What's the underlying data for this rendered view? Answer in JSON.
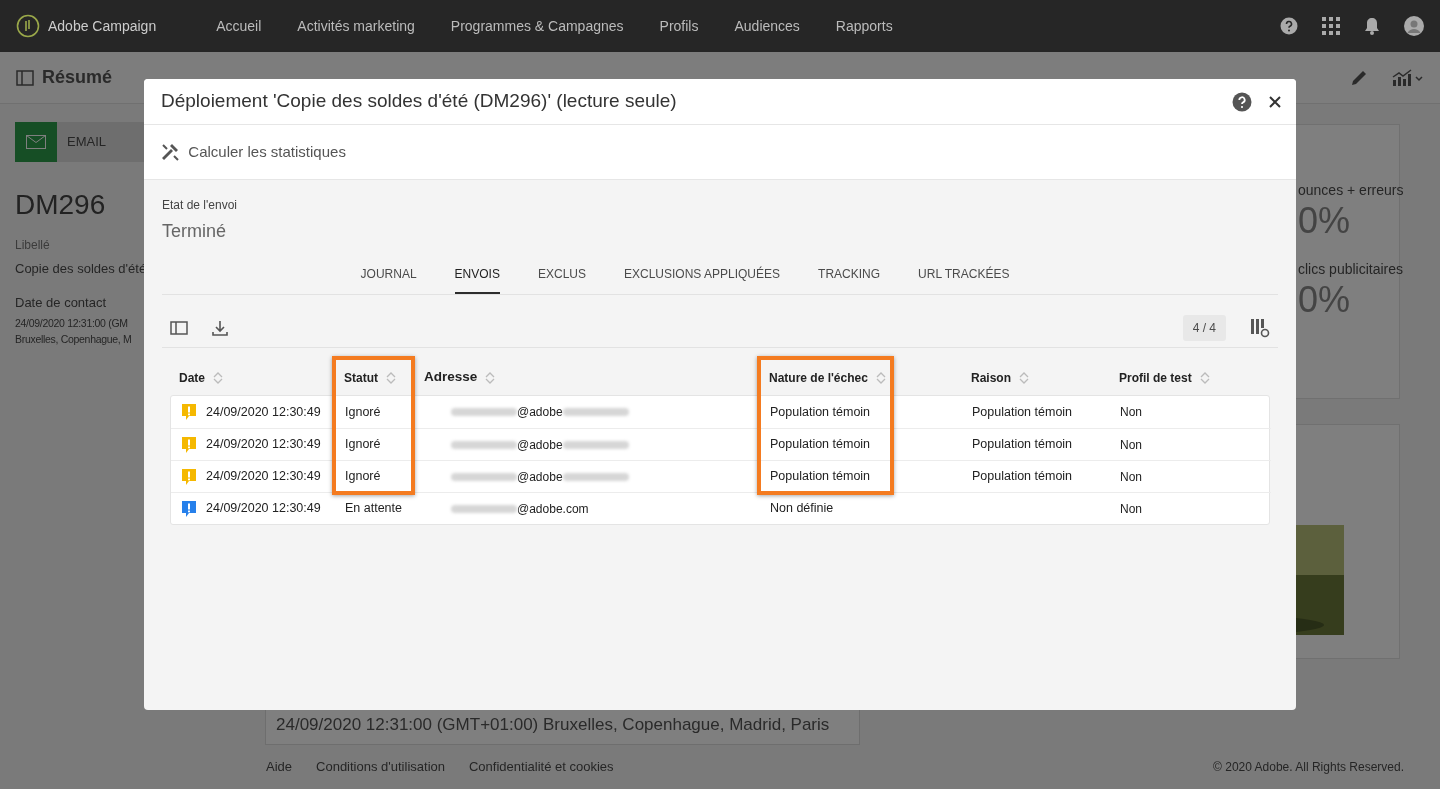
{
  "app": {
    "name": "Adobe Campaign"
  },
  "nav": [
    {
      "label": "Accueil"
    },
    {
      "label": "Activités marketing"
    },
    {
      "label": "Programmes & Campagnes"
    },
    {
      "label": "Profils"
    },
    {
      "label": "Audiences"
    },
    {
      "label": "Rapports"
    }
  ],
  "page": {
    "title": "Résumé"
  },
  "summary": {
    "channel": "EMAIL",
    "code": "DM296",
    "label_title": "Libellé",
    "label_value": "Copie des soldes d'été",
    "date_title": "Date de contact",
    "date_lines": [
      "24/09/2020 12:31:00 (GM",
      "Bruxelles, Copenhague, M"
    ]
  },
  "contact_field": "24/09/2020 12:31:00 (GMT+01:00) Bruxelles, Copenhague, Madrid, Paris",
  "stats": [
    {
      "label": "ounces + erreurs",
      "value": "0%"
    },
    {
      "label": "clics publicitaires",
      "value": "0%"
    }
  ],
  "footer": {
    "links": [
      "Aide",
      "Conditions d'utilisation",
      "Confidentialité et cookies"
    ],
    "copyright": "© 2020 Adobe. All Rights Reserved."
  },
  "dialog": {
    "title": "Déploiement 'Copie des soldes d'été (DM296)' (lecture seule)",
    "action": "Calculer les statistiques",
    "state_label": "Etat de l'envoi",
    "state_value": "Terminé",
    "tabs": [
      {
        "label": "JOURNAL",
        "selected": false
      },
      {
        "label": "ENVOIS",
        "selected": true
      },
      {
        "label": "EXCLUS",
        "selected": false
      },
      {
        "label": "EXCLUSIONS APPLIQUÉES",
        "selected": false
      },
      {
        "label": "TRACKING",
        "selected": false
      },
      {
        "label": "URL TRACKÉES",
        "selected": false
      }
    ],
    "count": "4 / 4",
    "columns": [
      {
        "label": "Date",
        "highlighted": false
      },
      {
        "label": "Statut",
        "highlighted": true
      },
      {
        "label": "Adresse",
        "highlighted": false
      },
      {
        "label": "Nature de l'échec",
        "highlighted": true
      },
      {
        "label": "Raison",
        "highlighted": false
      },
      {
        "label": "Profil de test",
        "highlighted": false
      }
    ],
    "rows": [
      {
        "kind": "warning",
        "date": "24/09/2020 12:30:49",
        "status": "Ignoré",
        "address": "@adobe",
        "blurred_suffix": true,
        "nature": "Population témoin",
        "reason": "Population témoin",
        "test_profile": "Non"
      },
      {
        "kind": "warning",
        "date": "24/09/2020 12:30:49",
        "status": "Ignoré",
        "address": "@adobe",
        "blurred_suffix": true,
        "nature": "Population témoin",
        "reason": "Population témoin",
        "test_profile": "Non"
      },
      {
        "kind": "warning",
        "date": "24/09/2020 12:30:49",
        "status": "Ignoré",
        "address": "@adobe",
        "blurred_suffix": true,
        "nature": "Population témoin",
        "reason": "Population témoin",
        "test_profile": "Non"
      },
      {
        "kind": "info",
        "date": "24/09/2020 12:30:49",
        "status": "En attente",
        "address": "@adobe.com",
        "blurred_suffix": false,
        "nature": "Non définie",
        "test_profile": "Non"
      }
    ]
  }
}
